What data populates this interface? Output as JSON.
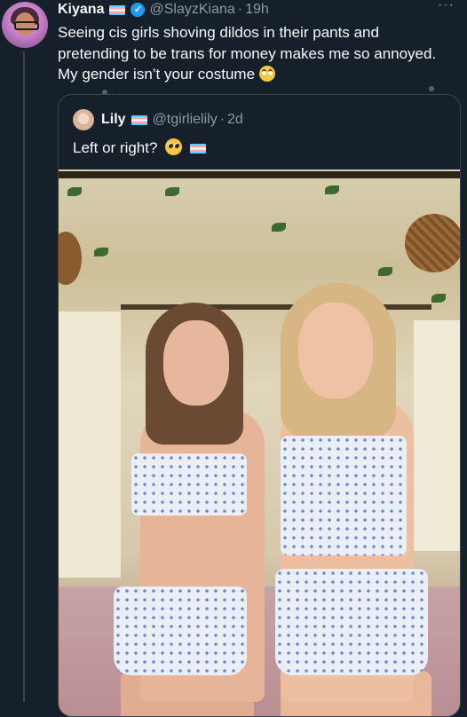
{
  "tweet": {
    "author_name": "Kiyana",
    "handle": "@SlayzKiana",
    "separator": "·",
    "time": "19h",
    "more": "···",
    "text": "Seeing cis girls shoving dildos in their pants and pretending to be trans for money makes me so annoyed. My gender isn’t your costume"
  },
  "quoted_tweet": {
    "author_name": "Lily",
    "handle": "@tgirlielily",
    "separator": "·",
    "time": "2d",
    "text": "Left or right?"
  },
  "icons": {
    "verified": "verified-badge-icon",
    "flag": "trans-flag-icon",
    "emoji_roll": "face-with-rolling-eyes-emoji",
    "emoji_plead": "pleading-face-emoji"
  },
  "colors": {
    "background": "#15202b",
    "muted": "#8b98a5",
    "border": "#38444d",
    "accent": "#1d9bf0"
  }
}
